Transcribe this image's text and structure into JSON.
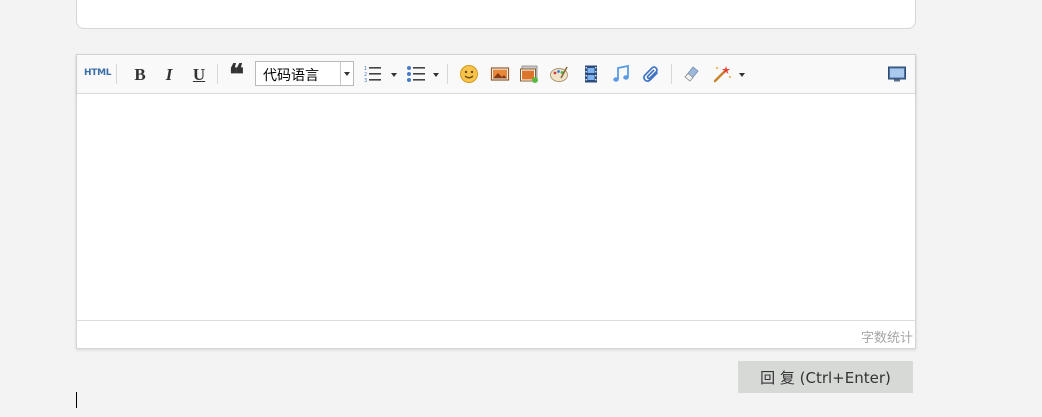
{
  "toolbar": {
    "html_label": "HTML",
    "bold_label": "B",
    "italic_label": "I",
    "underline_label": "U",
    "quote_label": "❝",
    "code_language": "代码语言",
    "icons": [
      "ordered-list-icon",
      "unordered-list-icon",
      "emoji-icon",
      "image-icon",
      "album-icon",
      "paint-palette-icon",
      "video-icon",
      "music-icon",
      "attachment-icon",
      "eraser-icon",
      "magic-wand-icon",
      "fullscreen-icon"
    ]
  },
  "editor": {
    "content": "",
    "word_count_label": "字数统计"
  },
  "submit_button": {
    "label": "回 复 (Ctrl+Enter)"
  },
  "colors": {
    "page_background": "#f3f3f3",
    "toolbar_background": "#f9f9f9",
    "button_background": "#d7d9d7",
    "html_accent": "#3a6ea8"
  }
}
